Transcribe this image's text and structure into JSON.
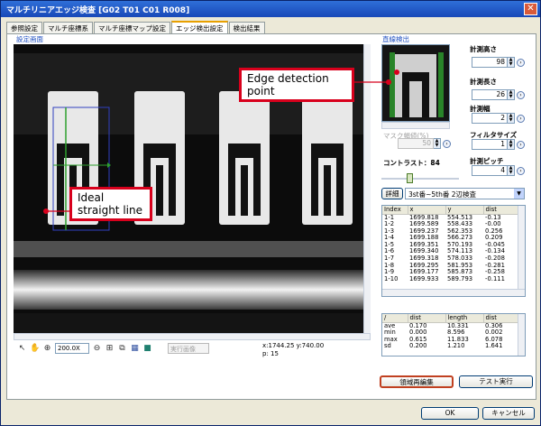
{
  "window": {
    "title": "マルチリニアエッジ検査 [G02 T01 C01 R008]",
    "close_label": "✕"
  },
  "tabs": [
    "参照設定",
    "マルチ座標系",
    "マルチ座標マップ設定",
    "エッジ検出設定",
    "検出結果"
  ],
  "image_group": {
    "label": "設定画面"
  },
  "toolbar": {
    "zoom_value": "200.0X",
    "display_select": "実行画像"
  },
  "coords": {
    "xy": "x:1744.25 y:740.00",
    "p": "p: 15"
  },
  "line_detect": {
    "label": "直線検出"
  },
  "fields": {
    "height": {
      "label": "計測高さ",
      "value": "98"
    },
    "length": {
      "label": "計測長さ",
      "value": "26"
    },
    "width": {
      "label": "計測幅",
      "value": "2"
    },
    "mask": {
      "label": "マスク幅値(%)",
      "value": "50"
    },
    "filter": {
      "label": "フィルタサイズ",
      "value": "1"
    },
    "pitch": {
      "label": "計測ピッチ",
      "value": "4"
    }
  },
  "contrast": {
    "label": "コントラスト：84",
    "value": 0.35
  },
  "detail_button": "詳細",
  "mode_combo": "3st番~5th番 2辺検査",
  "points_table": {
    "headers": [
      "Index",
      "x",
      "y",
      "dist"
    ],
    "rows": [
      [
        "1-1",
        "1699.818",
        "554.513",
        "-0.13"
      ],
      [
        "1-2",
        "1699.589",
        "558.433",
        "-0.00"
      ],
      [
        "1-3",
        "1699.237",
        "562.353",
        "0.256"
      ],
      [
        "1-4",
        "1699.188",
        "566.273",
        "0.209"
      ],
      [
        "1-5",
        "1699.351",
        "570.193",
        "-0.045"
      ],
      [
        "1-6",
        "1699.340",
        "574.113",
        "-0.134"
      ],
      [
        "1-7",
        "1699.318",
        "578.033",
        "-0.208"
      ],
      [
        "1-8",
        "1699.295",
        "581.953",
        "-0.281"
      ],
      [
        "1-9",
        "1699.177",
        "585.873",
        "-0.258"
      ],
      [
        "1-10",
        "1699.933",
        "589.793",
        "-0.111"
      ]
    ]
  },
  "stats_table": {
    "headers": [
      "/",
      "dist",
      "length",
      "dist"
    ],
    "rows": [
      [
        "ave",
        "0.170",
        "10.331",
        "0.306"
      ],
      [
        "min",
        "0.000",
        "8.596",
        "0.002"
      ],
      [
        "max",
        "0.615",
        "11.833",
        "6.078"
      ],
      [
        "sd",
        "0.200",
        "1.210",
        "1.641"
      ]
    ]
  },
  "buttons": {
    "region_edit": "領域再編集",
    "test_run": "テスト実行",
    "ok": "OK",
    "cancel": "キャンセル"
  },
  "callouts": {
    "edge": "Edge detection point",
    "line": "Ideal straight line"
  },
  "colors": {
    "callout_border": "#d8001c",
    "fit_line": "#2ea02e",
    "roi_box": "#3040c0"
  }
}
